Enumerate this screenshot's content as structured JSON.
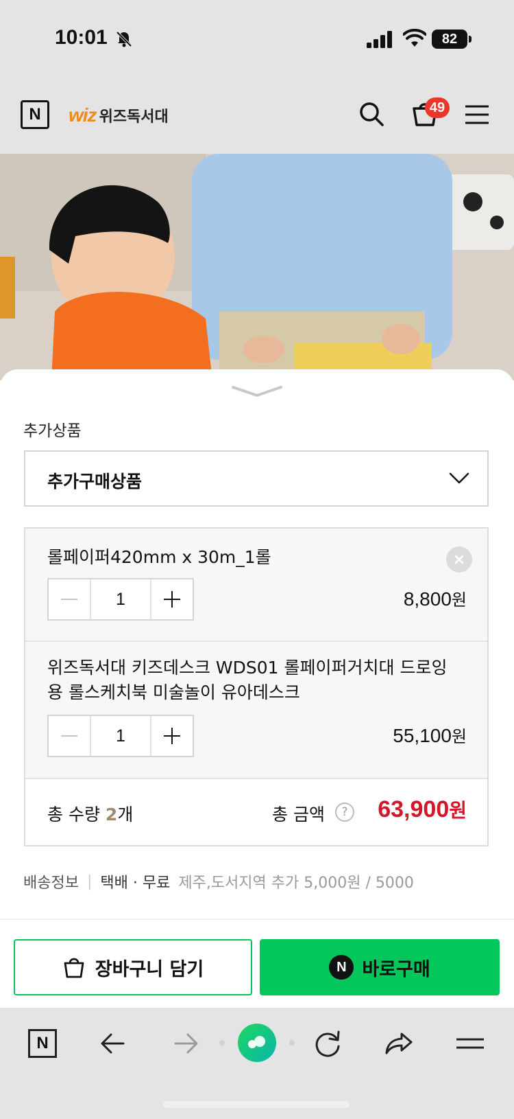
{
  "status_bar": {
    "time": "10:01",
    "battery": "82"
  },
  "header": {
    "logo_letter": "N",
    "brand_wiz": "wiz",
    "brand_name": "위즈독서대",
    "cart_count": "49"
  },
  "sheet": {
    "section_label": "추가상품",
    "dropdown_value": "추가구매상품",
    "items": [
      {
        "title": "롤페이퍼420mm x 30m_1롤",
        "quantity": "1",
        "price": "8,800",
        "currency": "원"
      },
      {
        "title": "위즈독서대 키즈데스크 WDS01 롤페이퍼거치대 드로잉용 롤스케치북 미술놀이 유아데스크",
        "quantity": "1",
        "price": "55,100",
        "currency": "원"
      }
    ],
    "total": {
      "qty_label": "총 수량",
      "qty_value": "2",
      "qty_unit": "개",
      "amount_label": "총 금액",
      "help": "?",
      "amount_value": "63,900",
      "currency": "원"
    },
    "shipping": {
      "label": "배송정보",
      "divider": "|",
      "method": "택배 · 무료",
      "extra": "제주,도서지역 추가 5,000원 / 5000"
    },
    "buttons": {
      "cart": "장바구니 담기",
      "buy_icon": "N",
      "buy": "바로구매"
    }
  },
  "browser_bar": {
    "home_letter": "N"
  },
  "colors": {
    "accent_green": "#03c75a",
    "price_red": "#d3172a",
    "badge_red": "#e8382c",
    "brand_orange": "#f08a1c"
  }
}
